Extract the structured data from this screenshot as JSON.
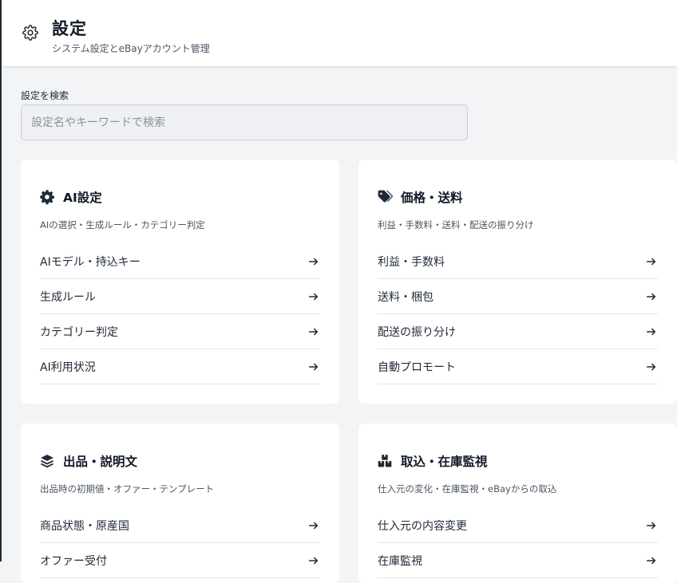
{
  "header": {
    "title": "設定",
    "subtitle": "システム設定とeBayアカウント管理",
    "icon": "gear-icon"
  },
  "search": {
    "label": "設定を検索",
    "placeholder": "設定名やキーワードで検索",
    "value": ""
  },
  "cards": [
    {
      "title": "AI設定",
      "icon": "gear-icon",
      "description": "AIの選択・生成ルール・カテゴリー判定",
      "items": [
        {
          "label": "AIモデル・持込キー"
        },
        {
          "label": "生成ルール"
        },
        {
          "label": "カテゴリー判定"
        },
        {
          "label": "AI利用状況"
        }
      ]
    },
    {
      "title": "価格・送料",
      "icon": "tags-icon",
      "description": "利益・手数料・送料・配送の振り分け",
      "items": [
        {
          "label": "利益・手数料"
        },
        {
          "label": "送料・梱包"
        },
        {
          "label": "配送の振り分け"
        },
        {
          "label": "自動プロモート"
        }
      ]
    },
    {
      "title": "出品・説明文",
      "icon": "layers-icon",
      "description": "出品時の初期値・オファー・テンプレート",
      "items": [
        {
          "label": "商品状態・原産国"
        },
        {
          "label": "オファー受付"
        }
      ]
    },
    {
      "title": "取込・在庫監視",
      "icon": "boxes-icon",
      "description": "仕入元の変化・在庫監視・eBayからの取込",
      "items": [
        {
          "label": "仕入元の内容変更"
        },
        {
          "label": "在庫監視"
        }
      ]
    }
  ],
  "colors": {
    "background": "#f3f4f6",
    "card": "#ffffff",
    "text": "#1f2937",
    "muted": "#4b5563"
  }
}
